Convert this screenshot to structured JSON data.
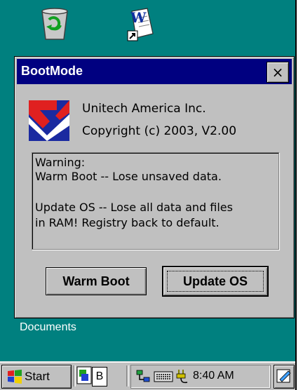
{
  "desktop": {
    "icons": [
      "recycle-bin-icon",
      "word-document-shortcut-icon"
    ],
    "documents_label": "Documents",
    "background_color": "#00807f"
  },
  "dialog": {
    "title": "BootMode",
    "close_label": "×",
    "company": "Unitech America Inc.",
    "copyright": "Copyright (c) 2003, V2.00",
    "warning_lines": [
      "Warning:",
      "Warm Boot -- Lose unsaved data.",
      "",
      "Update OS -- Lose all data and files",
      "in RAM! Registry back to default."
    ],
    "buttons": {
      "warm_boot": "Warm Boot",
      "update_os": "Update OS"
    },
    "titlebar_color": "#000080"
  },
  "taskbar": {
    "start_label": "Start",
    "app_button_label": "B",
    "clock": "8:40 AM",
    "tray_icons": [
      "network-icon",
      "keyboard-icon",
      "power-icon"
    ]
  }
}
